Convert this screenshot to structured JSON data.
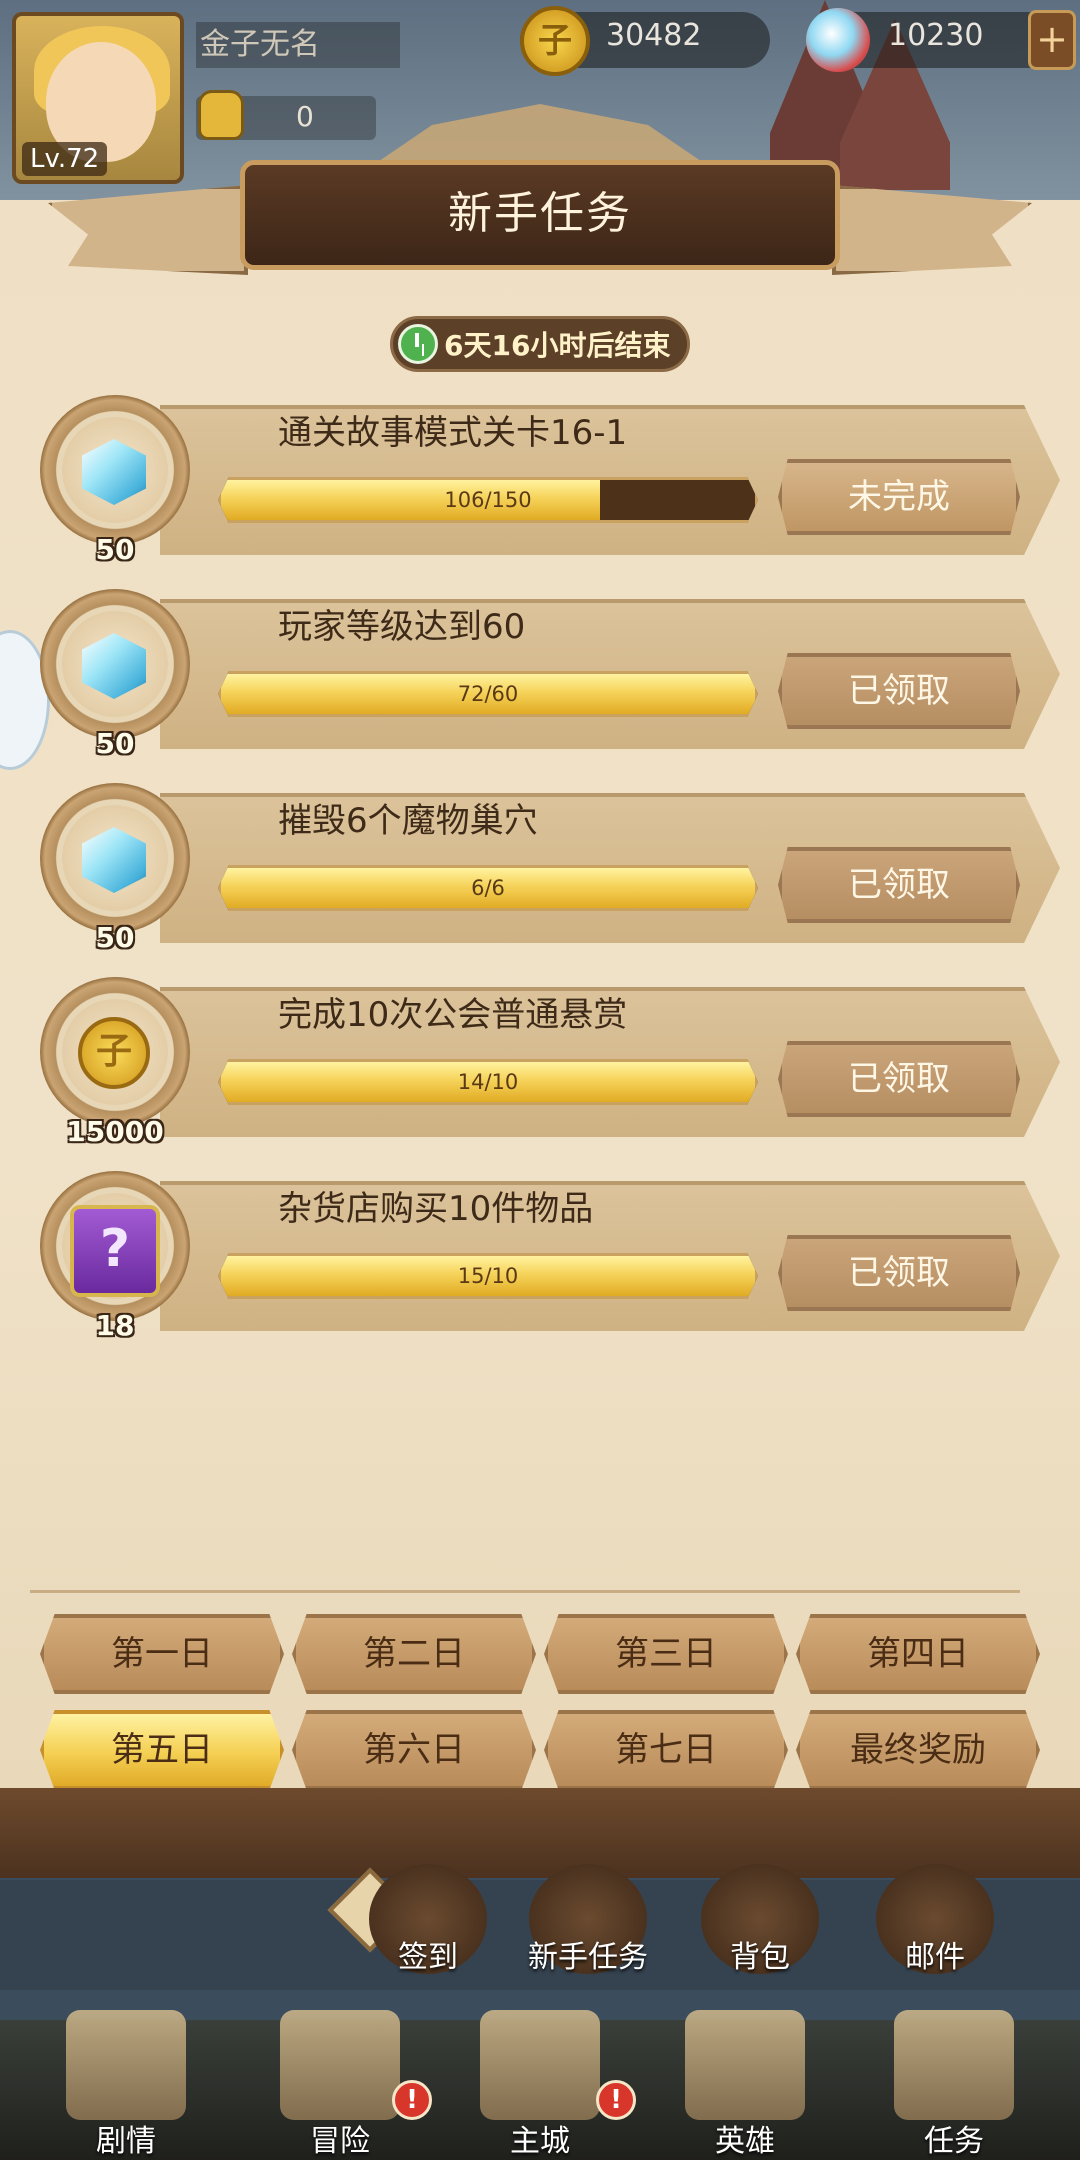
{
  "player": {
    "name": "金子无名",
    "level": "Lv.72",
    "power": "0"
  },
  "currency": {
    "gold": "30482",
    "gems": "10230",
    "coin_glyph": "子"
  },
  "panel": {
    "title": "新手任务",
    "timer": "6天16小时后结束"
  },
  "tasks": [
    {
      "title": "通关故事模式关卡16-1",
      "progress": "106/150",
      "fill": 0.71,
      "reward_icon": "gem-icon",
      "reward_count": "50",
      "status": "未完成"
    },
    {
      "title": "玩家等级达到60",
      "progress": "72/60",
      "fill": 1.0,
      "reward_icon": "gem-icon",
      "reward_count": "50",
      "status": "已领取"
    },
    {
      "title": "摧毁6个魔物巢穴",
      "progress": "6/6",
      "fill": 1.0,
      "reward_icon": "gem-icon",
      "reward_count": "50",
      "status": "已领取"
    },
    {
      "title": "完成10次公会普通悬赏",
      "progress": "14/10",
      "fill": 1.0,
      "reward_icon": "gold-coin-icon",
      "reward_count": "15000",
      "status": "已领取"
    },
    {
      "title": "杂货店购买10件物品",
      "progress": "15/10",
      "fill": 1.0,
      "reward_icon": "mystery-scroll-icon",
      "reward_count": "18",
      "status": "已领取"
    }
  ],
  "days": [
    "第一日",
    "第二日",
    "第三日",
    "第四日",
    "第五日",
    "第六日",
    "第七日",
    "最终奖励"
  ],
  "active_day": "第五日",
  "sub_menu": [
    "签到",
    "新手任务",
    "背包",
    "邮件"
  ],
  "nav": [
    "剧情",
    "冒险",
    "主城",
    "英雄",
    "任务"
  ],
  "badge_mark": "!",
  "colors": {
    "progress_fill": "#f6d35a",
    "active_tab": "#f4cf52",
    "badge": "#d8352b"
  }
}
